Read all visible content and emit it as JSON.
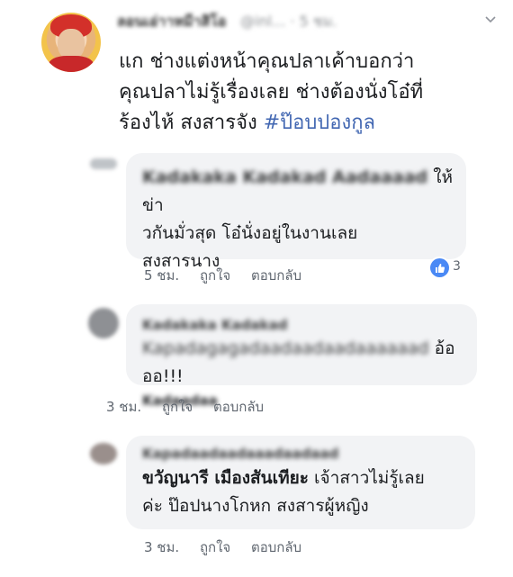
{
  "post": {
    "author": "ลอนเอ่าาหมีาสิโอ",
    "meta": "@inl... · 5 ชม.",
    "caret_icon": "chevron-down-icon",
    "line1": "แก ช่างแต่งหน้าคุณปลาเค้าบอกว่า",
    "line2": "คุณปลาไม่รู้เรื่องเลย ช่างต้องนั่งโอ๋ที่",
    "line3": "ร้องไห้ สงสารจัง ",
    "hashtag": "#ป๊อบปองกูล"
  },
  "comments": [
    {
      "author": "Kadakaka Kadakad Aadaaaad",
      "line1_suffix": "ให้ข่า",
      "line2": "วกันมั่วสุด  โอ๋นั่งอยู่ในงานเลย",
      "line3": "สงสารนาง",
      "time": "5 ชม.",
      "like": "ถูกใจ",
      "reply": "ตอบกลับ",
      "reaction_icon": "like-icon",
      "reaction_count": "3"
    },
    {
      "author": "Kadakaka Kadakad",
      "line1": "Kapadagagadaadaadaadaaaaaad",
      "line1_suffix": "อ้อออ!!!",
      "line2": "Kadaadaa",
      "time": "3 ชม.",
      "like": "ถูกใจ",
      "reply": "ตอบกลับ"
    },
    {
      "author": "Kapadaadaadaaadaadaad",
      "line1": "ขวัญนารี เมืองสันเทียะ",
      "line1_rest": " เจ้าสาวไม่รู้เลย",
      "line2": "ค่ะ ป๊อปนางโกหก สงสารผู้หญิง",
      "time": "3 ชม.",
      "like": "ถูกใจ",
      "reply": "ตอบกลับ"
    }
  ],
  "colors": {
    "link": "#4267b2",
    "bubble": "#f2f3f5",
    "like_badge": "#4a89f5"
  }
}
